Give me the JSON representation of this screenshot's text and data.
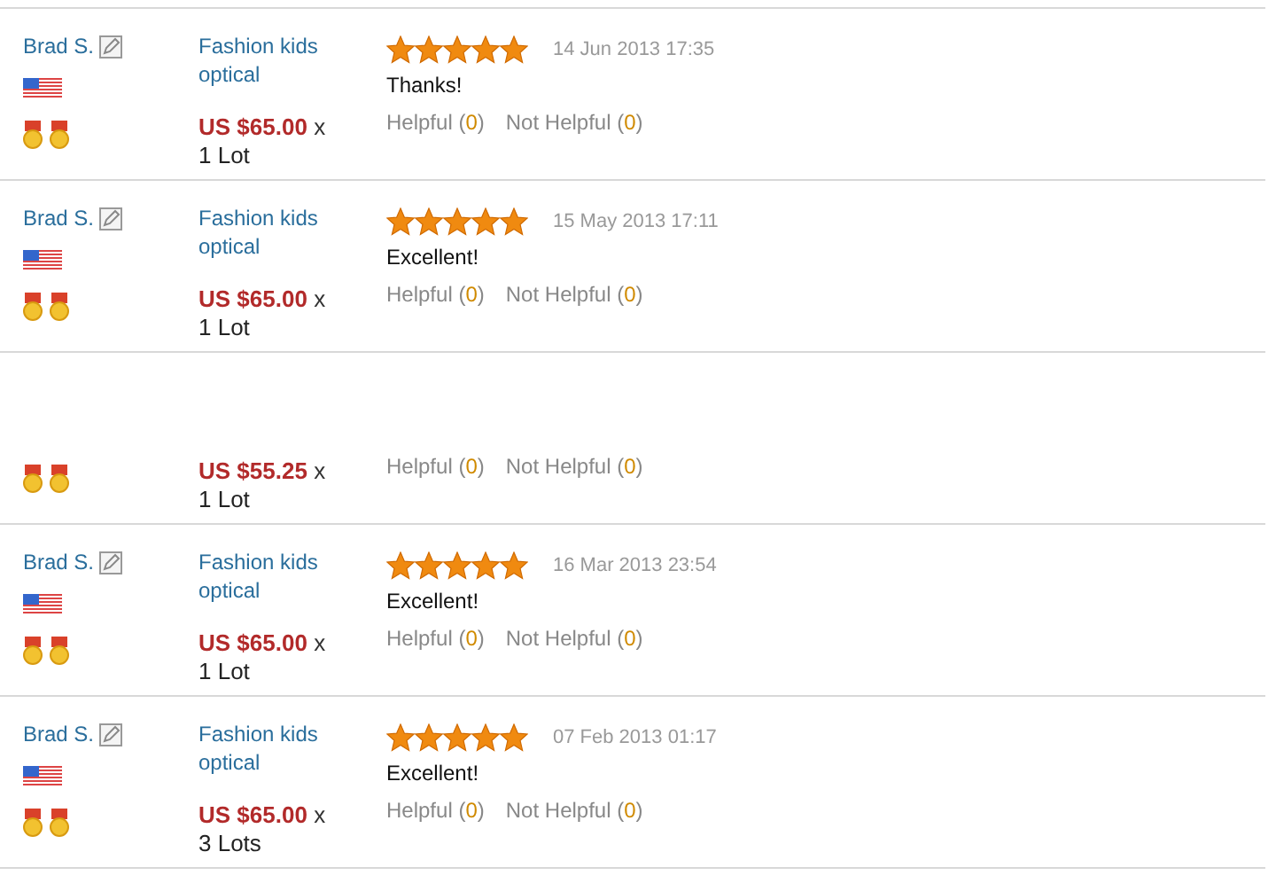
{
  "reviews": [
    {
      "name": "Brad S.",
      "product": "Fashion kids optical",
      "price": "US $65.00",
      "times": "x",
      "quantity": "1 Lot",
      "stars": 5,
      "date": "14 Jun 2013 17:35",
      "comment": "Thanks!",
      "helpful": "Helpful",
      "helpful_count": "(0)",
      "not_helpful": "Not Helpful",
      "not_helpful_count": "(0)"
    },
    {
      "name": "Brad S.",
      "product": "Fashion kids optical",
      "price": "US $65.00",
      "times": "x",
      "quantity": "1 Lot",
      "stars": 5,
      "date": "15 May 2013 17:11",
      "comment": "Excellent!",
      "helpful": "Helpful",
      "helpful_count": "(0)",
      "not_helpful": "Not Helpful",
      "not_helpful_count": "(0)"
    },
    {
      "price": "US $55.25",
      "times": "x",
      "quantity": "1 Lot",
      "helpful": "Helpful",
      "helpful_count": "(0)",
      "not_helpful": "Not Helpful",
      "not_helpful_count": "(0)"
    },
    {
      "name": "Brad S.",
      "product": "Fashion kids optical",
      "price": "US $65.00",
      "times": "x",
      "quantity": "1 Lot",
      "stars": 5,
      "date": "16 Mar 2013 23:54",
      "comment": "Excellent!",
      "helpful": "Helpful",
      "helpful_count": "(0)",
      "not_helpful": "Not Helpful",
      "not_helpful_count": "(0)"
    },
    {
      "name": "Brad S.",
      "product": "Fashion kids optical",
      "price": "US $65.00",
      "times": "x",
      "quantity": "3 Lots",
      "stars": 5,
      "date": "07 Feb 2013 01:17",
      "comment": "Excellent!",
      "helpful": "Helpful",
      "helpful_count": "(0)",
      "not_helpful": "Not Helpful",
      "not_helpful_count": "(0)"
    }
  ]
}
